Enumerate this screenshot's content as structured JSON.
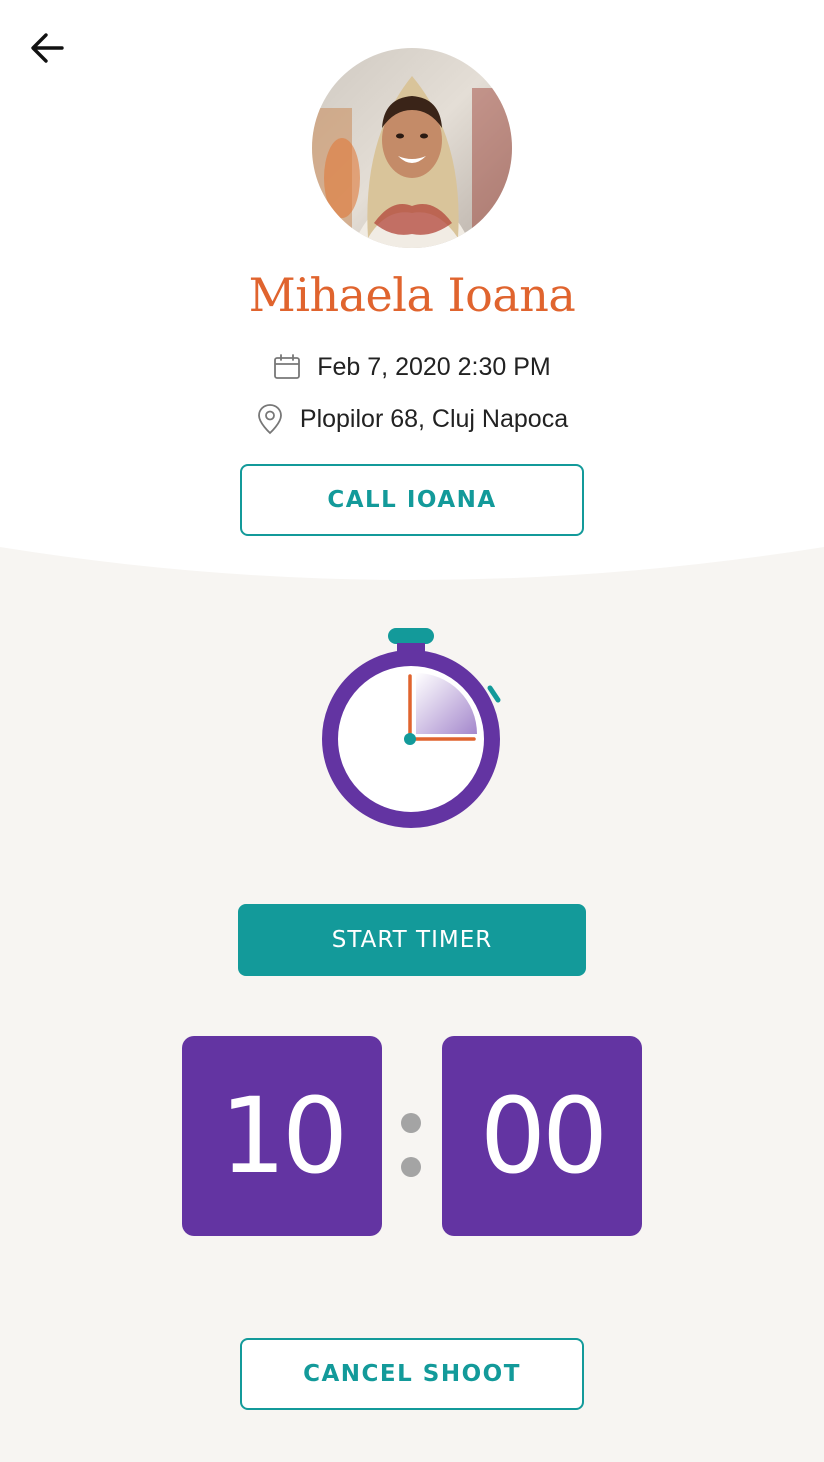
{
  "contact": {
    "name": "Mihaela Ioana",
    "datetime": "Feb 7, 2020 2:30 PM",
    "address": "Plopilor 68, Cluj Napoca",
    "call_label": "CALL IOANA"
  },
  "timer": {
    "start_label": "START TIMER",
    "minutes": "10",
    "seconds": "00"
  },
  "cancel_label": "CANCEL SHOOT",
  "colors": {
    "accent_teal": "#139a9a",
    "name_orange": "#e0642e",
    "timer_purple": "#6334a2",
    "bottom_bg": "#f7f5f2"
  },
  "icons": {
    "back": "arrow-left-icon",
    "calendar": "calendar-icon",
    "location": "map-pin-icon",
    "stopwatch": "stopwatch-icon"
  }
}
